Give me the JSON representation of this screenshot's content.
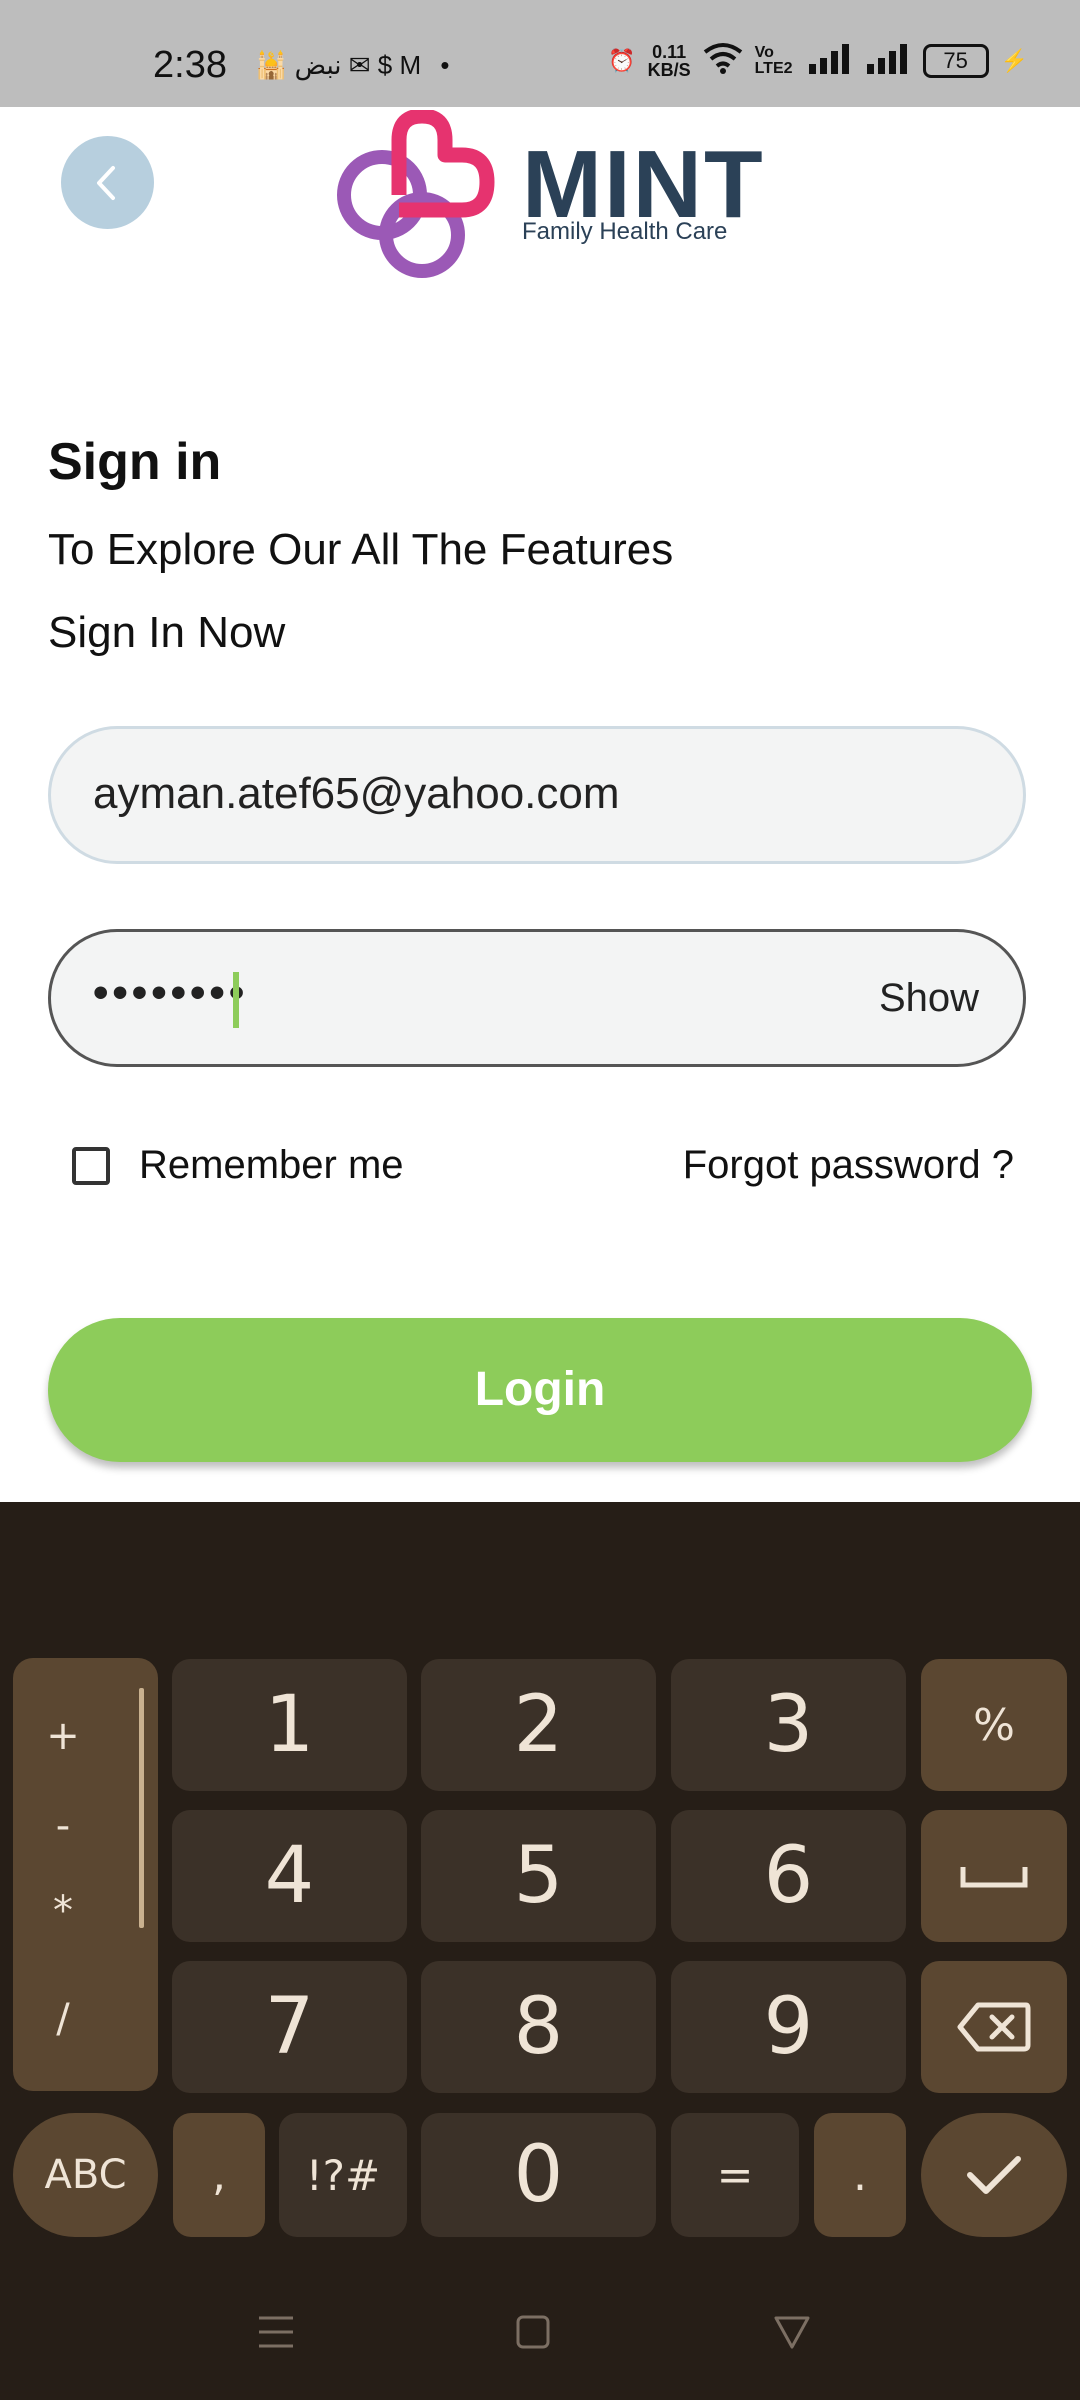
{
  "status_bar": {
    "time": "2:38",
    "left_icons": "🕌 نبض ✉ $ M •",
    "net_speed": "0.11\nKB/S",
    "network": "Vo LTE2",
    "battery": "75"
  },
  "header": {
    "logo_word": "MINT",
    "logo_sub": "Family Health Care",
    "logo_colors": {
      "pink": "#e6336f",
      "purple": "#9b59b6",
      "text": "#2b4157"
    }
  },
  "page": {
    "title": "Sign in",
    "subtitle_line1": "To Explore Our All The Features",
    "subtitle_line2": "Sign In Now"
  },
  "form": {
    "email_value": "ayman.atef65@yahoo.com",
    "password_value": "••••••••",
    "show_label": "Show",
    "remember_label": "Remember me",
    "forgot_label": "Forgot password ?",
    "login_label": "Login"
  },
  "keyboard": {
    "row1": [
      "1",
      "2",
      "3",
      "%"
    ],
    "row2": [
      "4",
      "5",
      "6",
      "␣"
    ],
    "row3": [
      "7",
      "8",
      "9",
      "⌫"
    ],
    "row4": [
      "ABC",
      ",",
      "!?#",
      "0",
      "=",
      ".",
      "✓"
    ],
    "ops": [
      "+",
      "-",
      "*",
      "/"
    ]
  },
  "colors": {
    "accent_green": "#8dcc5a",
    "keyboard_bg": "#261e17",
    "key_bg": "#3b3128",
    "key_accent": "#5b4731"
  }
}
